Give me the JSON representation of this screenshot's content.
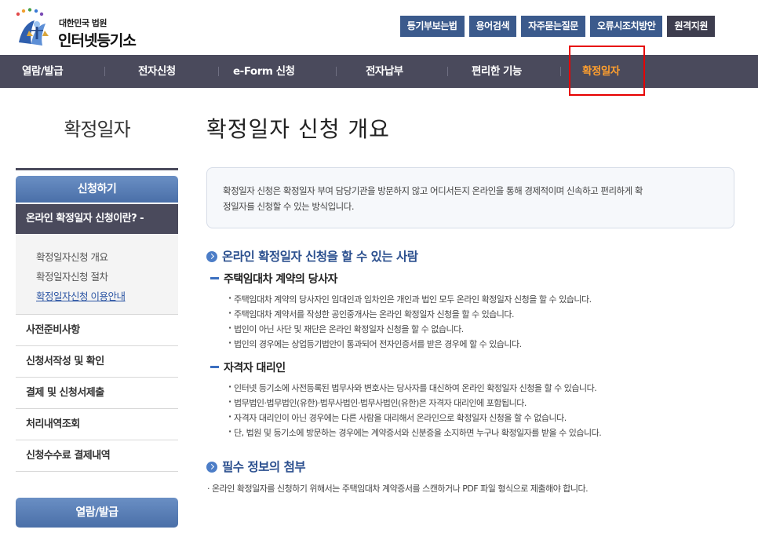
{
  "logo": {
    "org": "대한민국 법원",
    "name": "인터넷등기소"
  },
  "top_util": [
    {
      "label": "등기부보는법",
      "style": "blue"
    },
    {
      "label": "용어검색",
      "style": "blue"
    },
    {
      "label": "자주묻는질문",
      "style": "blue"
    },
    {
      "label": "오류시조치방안",
      "style": "blue"
    },
    {
      "label": "원격지원",
      "style": "dark"
    }
  ],
  "gnb": [
    {
      "label": "열람/발급"
    },
    {
      "label": "전자신청"
    },
    {
      "label": "e-Form 신청"
    },
    {
      "label": "전자납부"
    },
    {
      "label": "편리한 기능"
    },
    {
      "label": "확정일자",
      "active": true
    }
  ],
  "sidebar": {
    "title": "확정일자",
    "tab": "신청하기",
    "current": "온라인 확정일자 신청이란? -",
    "sub_items": [
      "확정일자신청 개요",
      "확정일자신청 절차",
      "확정일자신청 이용안내"
    ],
    "menu_items": [
      "사전준비사항",
      "신청서작성 및 확인",
      "결제 및 신청서제출",
      "처리내역조회",
      "신청수수료 결제내역"
    ],
    "bottom_button": "열람/발급"
  },
  "main": {
    "title": "확정일자 신청 개요",
    "intro_line1": "확정일자 신청은 확정일자 부여 담당기관을 방문하지 않고 어디서든지 온라인을 통해 경제적이며 신속하고 편리하게 확",
    "intro_line2": "정일자를 신청할 수 있는 방식입니다.",
    "section1": {
      "heading": "온라인 확정일자 신청을 할 수 있는 사람",
      "group1": {
        "heading": "주택임대차 계약의 당사자",
        "items": [
          "주택임대차 계약의 당사자인 임대인과 임차인은 개인과 법인 모두 온라인 확정일자 신청을 할 수 있습니다.",
          "주택임대차 계약서를 작성한 공인중개사는 온라인 확정일자 신청을 할 수 있습니다.",
          "법인이 아닌 사단 및 재단은 온라인 확정일자 신청을 할 수 없습니다.",
          "법인의 경우에는 상업등기법안이 통과되어 전자인증서를 받은 경우에 할 수 있습니다."
        ]
      },
      "group2": {
        "heading": "자격자 대리인",
        "items": [
          "인터넷 등기소에 사전등록된 법무사와 변호사는 당사자를 대신하여 온라인 확정일자 신청을 할 수 있습니다.",
          "법무법인·법무법인(유한)·법무사법인·법무사법인(유한)은 자격자 대리인에 포함됩니다.",
          "자격자 대리인이 아닌 경우에는 다른 사람을 대리해서 온라인으로 확정일자 신청을 할 수 없습니다.",
          "단, 법원 및 등기소에 방문하는 경우에는 계약증서와 신분증을 소지하면 누구나 확정일자를 받을 수 있습니다."
        ]
      }
    },
    "section2": {
      "heading": "필수 정보의 첨부",
      "note": "온라인 확정일자를 신청하기 위해서는 주택임대차 계약증서를 스캔하거나 PDF 파일 형식으로 제출해야 합니다."
    }
  }
}
